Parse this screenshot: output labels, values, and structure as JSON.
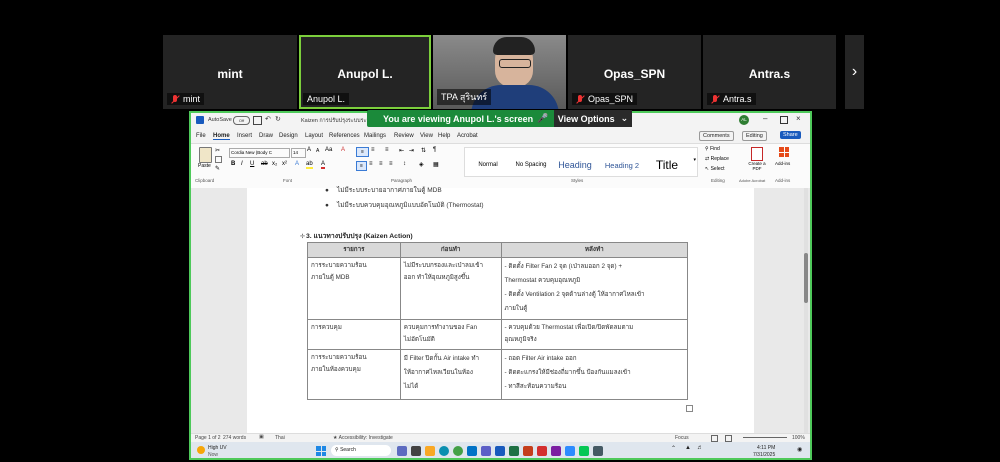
{
  "participants": [
    {
      "name": "mint",
      "tag": "mint"
    },
    {
      "name": "Anupol L.",
      "tag": "Anupol L."
    },
    {
      "name": "",
      "tag": "TPA สุรินทร์"
    },
    {
      "name": "Opas_SPN",
      "tag": "Opas_SPN"
    },
    {
      "name": "Antra.s",
      "tag": "Antra.s"
    }
  ],
  "banner": {
    "text": "You are viewing  Anupol L.'s screen",
    "options_label": "View Options"
  },
  "word": {
    "title_bar": {
      "autosave": "AutoSave",
      "toggle": "Off",
      "filename": "Kaizen การปรับปรุงระบบระบายความร้อน...",
      "user_initials": "AL"
    },
    "menu": [
      "File",
      "Home",
      "Insert",
      "Draw",
      "Design",
      "Layout",
      "References",
      "Mailings",
      "Review",
      "View",
      "Help",
      "Acrobat"
    ],
    "comments_label": "Comments",
    "editing_label": "Editing",
    "share_label": "Share",
    "font_name": "Cordia New (Body C",
    "font_size": "14",
    "paste_label": "Paste",
    "group_labels": {
      "clipboard": "Clipboard",
      "font": "Font",
      "paragraph": "Paragraph",
      "styles": "Styles",
      "editing": "Editing",
      "adobe": "Adobe Acrobat",
      "addins": "Add-ins"
    },
    "styles": [
      "Normal",
      "No Spacing",
      "Heading",
      "Heading 2",
      "Title"
    ],
    "editing_items": [
      "Find",
      "Replace",
      "Select"
    ],
    "create_pdf": "Create a PDF",
    "addins": "Add-ins",
    "doc": {
      "bullets": [
        "ไม่มีระบบระบายอากาศภายในตู้ MDB",
        "ไม่มีระบบควบคุมอุณหภูมิแบบอัตโนมัติ (Thermostat)"
      ],
      "section_title": "3. แนวทางปรับปรุง (Kaizen Action)",
      "table": {
        "headers": [
          "รายการ",
          "ก่อนทำ",
          "หลังทำ"
        ],
        "rows": [
          {
            "item": [
              "การระบายความร้อน",
              "ภายในตู้ MDB"
            ],
            "before": [
              "ไม่มีระบบกรองและเป่าลมเข้า",
              "ออก ทำให้อุณหภูมิสูงขึ้น"
            ],
            "after": [
              "- ติดตั้ง Filter Fan 2 จุด (เป่าลมออก 2 จุด) +",
              "Thermostat ควบคุมอุณหภูมิ",
              "- ติดตั้ง Ventilation 2 จุดด้านล่างตู้ ให้อากาศไหลเข้า",
              "ภายในตู้"
            ]
          },
          {
            "item": [
              "การควบคุม"
            ],
            "before": [
              "ควบคุมการทำงานของ Fan",
              "ไม่อัตโนมัติ"
            ],
            "after": [
              "- ควบคุมด้วย Thermostat เพื่อเปิด/ปิดพัดลมตาม",
              "อุณหภูมิจริง"
            ]
          },
          {
            "item": [
              "การระบายความร้อน",
              "ภายในห้องควบคุม"
            ],
            "before": [
              "มี Filter ปิดกั้น Air intake ทำ",
              "ให้อากาศไหลเวียนในห้อง",
              "ไม่ได้"
            ],
            "after": [
              "- ถอด Filter Air intake ออก",
              "- ติดตะแกรงให้มีช่องถี่มากขึ้น ป้องกันแมลงเข้า",
              "- ทาสีสะท้อนความร้อน"
            ]
          }
        ]
      }
    },
    "status": {
      "page": "Page 1 of 2",
      "words": "274 words",
      "lang": "Thai",
      "accessibility": "Accessibility: Investigate",
      "focus": "Focus",
      "zoom": "100%"
    },
    "taskbar": {
      "weather_title": "High UV",
      "weather_sub": "Now",
      "search": "Search",
      "time": "4:11 PM",
      "date": "7/31/2025"
    }
  }
}
